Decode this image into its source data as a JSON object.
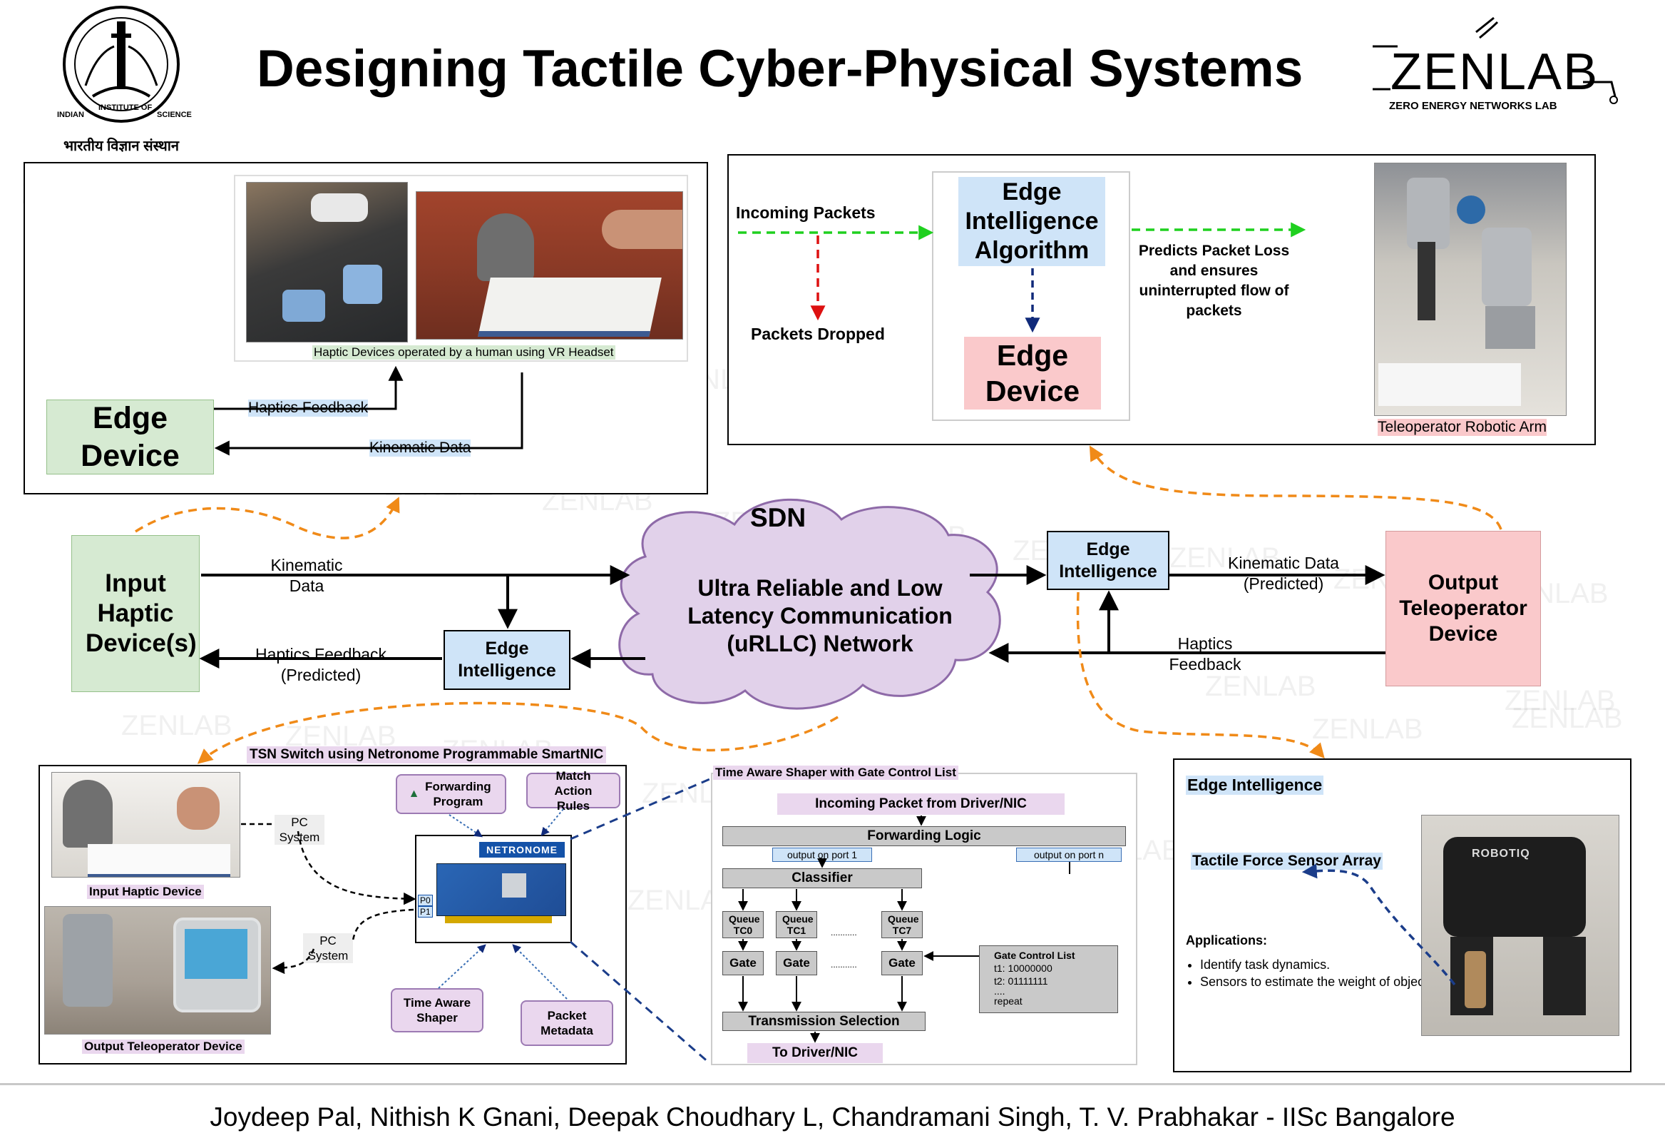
{
  "header": {
    "title": "Designing Tactile Cyber-Physical Systems",
    "iisc_logo": {
      "ring_text_left": "INDIAN",
      "ring_text_top": "INSTITUTE OF",
      "ring_text_right": "SCIENCE",
      "hindi": "भारतीय विज्ञान संस्थान"
    },
    "zenlab_logo": {
      "name": "ZENLAB",
      "sub": "ZERO ENERGY NETWORKS LAB"
    }
  },
  "watermark": "ZENLAB",
  "panel_tl": {
    "photo_caption": "Haptic Devices operated by a human using VR Headset",
    "edge_device": "Edge Device",
    "haptics_feedback": "Haptics Feedback",
    "kinematic_data": "Kinematic Data"
  },
  "panel_tr": {
    "incoming_packets": "Incoming Packets",
    "packets_dropped": "Packets Dropped",
    "algo_box": "Edge Intelligence Algorithm",
    "edge_device": "Edge Device",
    "predicts": "Predicts Packet Loss and ensures uninterrupted flow of packets",
    "robot_caption": "Teleoperator Robotic Arm"
  },
  "middle": {
    "input_device": "Input Haptic Device(s)",
    "kinematic_data": "Kinematic Data",
    "haptics_feedback_predicted": "Haptics Feedback (Predicted)",
    "edge_intel_left": "Edge Intelligence",
    "sdn": "SDN",
    "cloud_text": "Ultra Reliable and Low Latency Communication (uRLLC) Network",
    "edge_intel_right": "Edge Intelligence",
    "kinematic_predicted": "Kinematic Data (Predicted)",
    "haptics_feedback": "Haptics Feedback",
    "output_device": "Output Teleoperator Device"
  },
  "panel_bl": {
    "title": "TSN Switch using Netronome Programmable SmartNIC",
    "input_caption": "Input Haptic Device",
    "output_caption": "Output Teleoperator Device",
    "pc_system_1": "PC System",
    "pc_system_2": "PC System",
    "forwarding_program": "Forwarding Program",
    "match_action_rules": "Match Action Rules",
    "time_aware_shaper": "Time Aware Shaper",
    "packet_metadata": "Packet Metadata",
    "netronome": "NETRONOME",
    "port0": "P0",
    "port1": "P1"
  },
  "panel_bc": {
    "title": "Time Aware Shaper with Gate Control List",
    "incoming": "Incoming Packet from Driver/NIC",
    "forwarding_logic": "Forwarding Logic",
    "output_port1": "output on port 1",
    "output_portn": "output on port n",
    "classifier": "Classifier",
    "queues": [
      "Queue TC0",
      "Queue TC1",
      "Queue TC7"
    ],
    "gates": [
      "Gate",
      "Gate",
      "Gate"
    ],
    "dots": "...........",
    "gcl_title": "Gate Control List",
    "gcl_t1": "t1: 10000000",
    "gcl_t2": "t2: 01111111",
    "gcl_dots": "....",
    "gcl_repeat": "repeat",
    "transmission": "Transmission Selection",
    "to_driver": "To Driver/NIC"
  },
  "panel_br": {
    "title": "Edge Intelligence",
    "sensor": "Tactile Force Sensor Array",
    "applications": "Applications:",
    "bullets": [
      "Identify task dynamics.",
      "Sensors to estimate the weight of object."
    ],
    "brand": "ROBOTIQ"
  },
  "footer": {
    "authors": "Joydeep Pal,  Nithish K Gnani,  Deepak Choudhary L,  Chandramani Singh,  T. V. Prabhakar - IISc Bangalore"
  }
}
